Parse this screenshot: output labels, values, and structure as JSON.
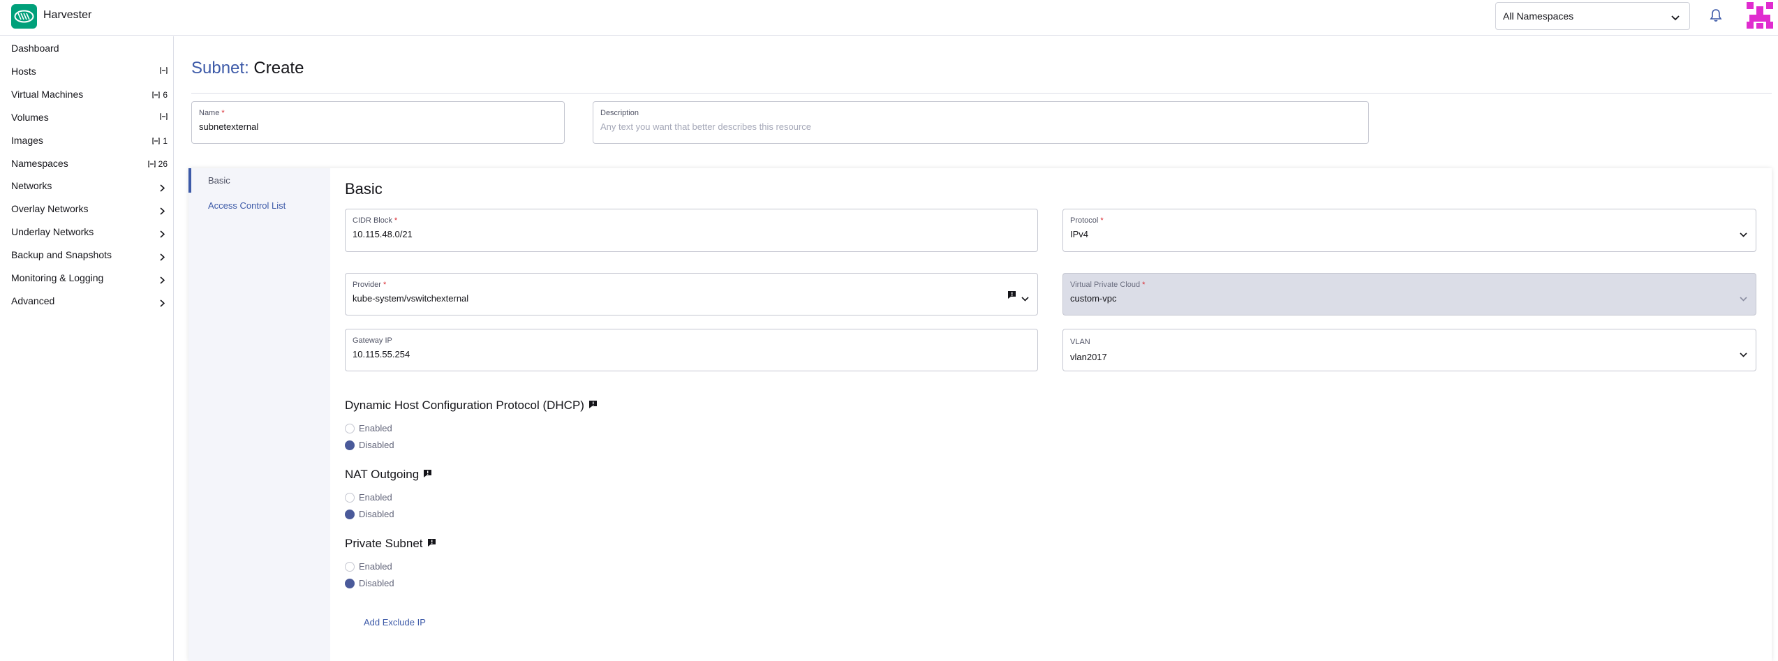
{
  "header": {
    "app_name": "Harvester",
    "namespace_select": "All Namespaces"
  },
  "sidebar": {
    "items": [
      {
        "label": "Dashboard",
        "badge": ""
      },
      {
        "label": "Hosts",
        "badge": ""
      },
      {
        "label": "Virtual Machines",
        "badge": "6"
      },
      {
        "label": "Volumes",
        "badge": ""
      },
      {
        "label": "Images",
        "badge": "1"
      },
      {
        "label": "Namespaces",
        "badge": "26"
      },
      {
        "label": "Networks",
        "badge": ""
      },
      {
        "label": "Overlay Networks",
        "badge": ""
      },
      {
        "label": "Underlay Networks",
        "badge": ""
      },
      {
        "label": "Backup and Snapshots",
        "badge": ""
      },
      {
        "label": "Monitoring & Logging",
        "badge": ""
      },
      {
        "label": "Advanced",
        "badge": ""
      }
    ]
  },
  "page": {
    "crumb": "Subnet:",
    "title": "Create"
  },
  "name_field": {
    "label": "Name",
    "value": "subnetexternal"
  },
  "description_field": {
    "label": "Description",
    "placeholder": "Any text you want that better describes this resource"
  },
  "tabs": {
    "basic": "Basic",
    "acl": "Access Control List"
  },
  "basic": {
    "heading": "Basic",
    "cidr": {
      "label": "CIDR Block",
      "value": "10.115.48.0/21"
    },
    "protocol": {
      "label": "Protocol",
      "value": "IPv4"
    },
    "provider": {
      "label": "Provider",
      "value": "kube-system/vswitchexternal"
    },
    "vpc": {
      "label": "Virtual Private Cloud",
      "value": "custom-vpc"
    },
    "gateway": {
      "label": "Gateway IP",
      "value": "10.115.55.254"
    },
    "vlan": {
      "label": "VLAN",
      "value": "vlan2017"
    }
  },
  "dhcp": {
    "heading": "Dynamic Host Configuration Protocol (DHCP)",
    "enabled": "Enabled",
    "disabled": "Disabled"
  },
  "nat": {
    "heading": "NAT Outgoing",
    "enabled": "Enabled",
    "disabled": "Disabled"
  },
  "private": {
    "heading": "Private Subnet",
    "enabled": "Enabled",
    "disabled": "Disabled"
  },
  "add_exclude_ip": "Add Exclude IP",
  "colors": {
    "accent": "#3d5aa8",
    "brand": "#00a07a",
    "required": "#d9262d"
  },
  "icons": [
    "harvester-logo-icon",
    "chevron-down-icon",
    "bell-icon",
    "user-avatar-icon",
    "badge-icon",
    "chevron-right-icon",
    "info-icon"
  ]
}
